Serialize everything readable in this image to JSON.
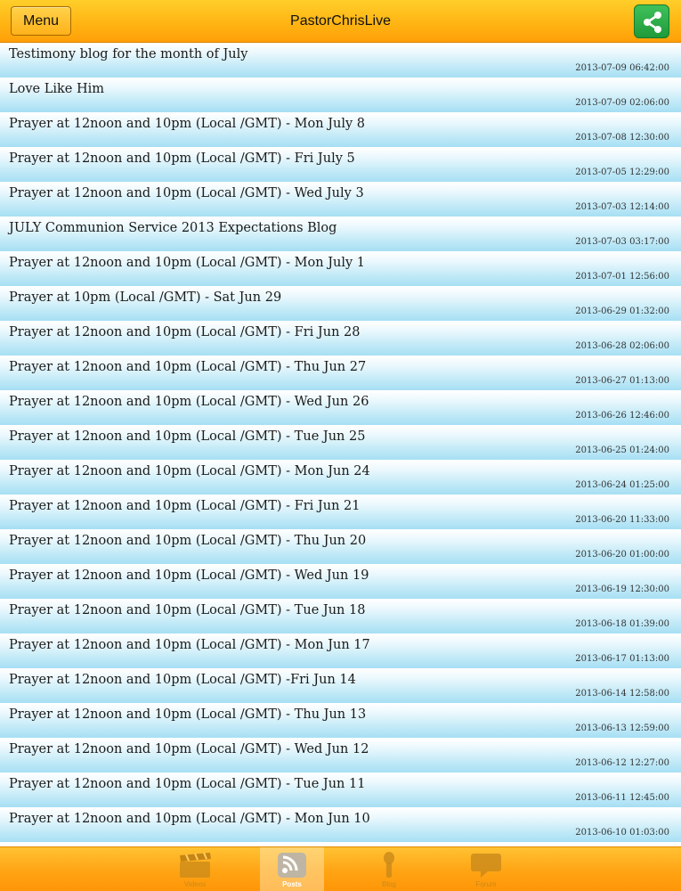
{
  "header": {
    "menu_label": "Menu",
    "title": "PastorChrisLive",
    "share_icon": "share-icon"
  },
  "posts": [
    {
      "title": "Testimony blog for the month of July",
      "date": "2013-07-09 06:42:00"
    },
    {
      "title": "Love Like Him",
      "date": "2013-07-09 02:06:00"
    },
    {
      "title": "Prayer at 12noon and 10pm (Local /GMT) - Mon July 8",
      "date": "2013-07-08 12:30:00"
    },
    {
      "title": "Prayer at 12noon and 10pm (Local /GMT) - Fri July 5",
      "date": "2013-07-05 12:29:00"
    },
    {
      "title": "Prayer at 12noon and 10pm (Local /GMT) - Wed July 3",
      "date": "2013-07-03 12:14:00"
    },
    {
      "title": "JULY Communion Service 2013 Expectations Blog",
      "date": "2013-07-03 03:17:00"
    },
    {
      "title": "Prayer at 12noon and 10pm (Local /GMT) - Mon July 1",
      "date": "2013-07-01 12:56:00"
    },
    {
      "title": "Prayer at 10pm (Local /GMT) - Sat Jun 29",
      "date": "2013-06-29 01:32:00"
    },
    {
      "title": "Prayer at 12noon and 10pm (Local /GMT) - Fri Jun 28",
      "date": "2013-06-28 02:06:00"
    },
    {
      "title": "Prayer at 12noon and 10pm (Local /GMT) - Thu Jun 27",
      "date": "2013-06-27 01:13:00"
    },
    {
      "title": "Prayer at 12noon and 10pm (Local /GMT) - Wed Jun 26",
      "date": "2013-06-26 12:46:00"
    },
    {
      "title": "Prayer at 12noon and 10pm (Local /GMT) - Tue Jun 25",
      "date": "2013-06-25 01:24:00"
    },
    {
      "title": "Prayer at 12noon and 10pm (Local /GMT) - Mon Jun 24",
      "date": "2013-06-24 01:25:00"
    },
    {
      "title": "Prayer at 12noon and 10pm (Local /GMT) - Fri Jun 21",
      "date": "2013-06-20 11:33:00"
    },
    {
      "title": "Prayer at 12noon and 10pm (Local /GMT) - Thu Jun 20",
      "date": "2013-06-20 01:00:00"
    },
    {
      "title": "Prayer at 12noon and 10pm (Local /GMT) - Wed Jun 19",
      "date": "2013-06-19 12:30:00"
    },
    {
      "title": "Prayer at 12noon and 10pm (Local /GMT) - Tue Jun 18",
      "date": "2013-06-18 01:39:00"
    },
    {
      "title": "Prayer at 12noon and 10pm (Local /GMT) - Mon Jun 17",
      "date": "2013-06-17 01:13:00"
    },
    {
      "title": "Prayer at 12noon and 10pm (Local /GMT) -Fri Jun 14",
      "date": "2013-06-14 12:58:00"
    },
    {
      "title": "Prayer at 12noon and 10pm (Local /GMT) - Thu Jun 13",
      "date": "2013-06-13 12:59:00"
    },
    {
      "title": "Prayer at 12noon and 10pm (Local /GMT) - Wed Jun 12",
      "date": "2013-06-12 12:27:00"
    },
    {
      "title": "Prayer at 12noon and 10pm (Local /GMT) - Tue Jun 11",
      "date": "2013-06-11 12:45:00"
    },
    {
      "title": "Prayer at 12noon and 10pm (Local /GMT) - Mon Jun 10",
      "date": "2013-06-10 01:03:00"
    }
  ],
  "tabbar": {
    "active_index": 1,
    "tabs": [
      {
        "label": "Videos",
        "icon": "clapperboard-icon"
      },
      {
        "label": "Posts",
        "icon": "rss-icon"
      },
      {
        "label": "Blog",
        "icon": "microphone-icon"
      },
      {
        "label": "Forum",
        "icon": "speech-bubble-icon"
      }
    ]
  },
  "colors": {
    "header_accent": "#ffb514",
    "row_blue": "#a6dff4",
    "share_green": "#1f9a3a"
  }
}
